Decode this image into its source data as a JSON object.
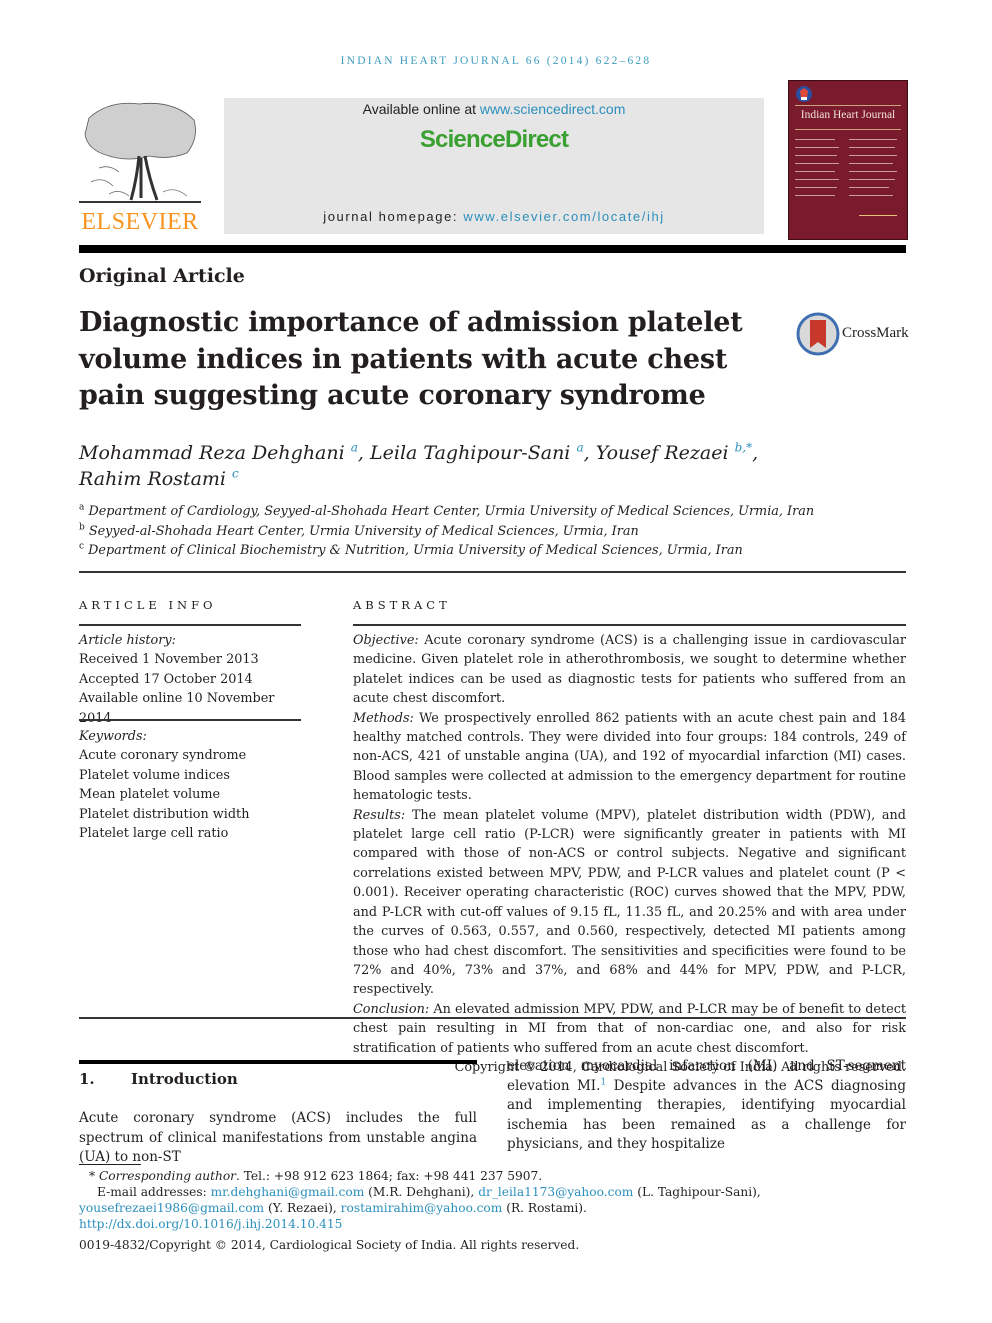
{
  "running_head": "INDIAN HEART JOURNAL 66 (2014) 622–628",
  "publisher": {
    "logo_text": "ELSEVIER"
  },
  "sciencedirect": {
    "available_prefix": "Available online at ",
    "available_link": "www.sciencedirect.com",
    "brand": "ScienceDirect",
    "homepage_prefix": "journal homepage: ",
    "homepage_link": "www.elsevier.com/locate/ihj"
  },
  "journal_cover": {
    "title": "Indian Heart Journal"
  },
  "article_type": "Original Article",
  "title": "Diagnostic importance of admission platelet volume indices in patients with acute chest pain suggesting acute coronary syndrome",
  "crossmark_label": "CrossMark",
  "authors": [
    {
      "name": "Mohammad Reza Dehghani",
      "aff": "a",
      "sep": ", "
    },
    {
      "name": "Leila Taghipour-Sani",
      "aff": "a",
      "sep": ", "
    },
    {
      "name": "Yousef Rezaei",
      "aff": "b,*",
      "sep": ","
    },
    {
      "name": "Rahim Rostami",
      "aff": "c",
      "sep": ""
    }
  ],
  "affiliations": [
    {
      "key": "a",
      "text": "Department of Cardiology, Seyyed-al-Shohada Heart Center, Urmia University of Medical Sciences, Urmia, Iran"
    },
    {
      "key": "b",
      "text": "Seyyed-al-Shohada Heart Center, Urmia University of Medical Sciences, Urmia, Iran"
    },
    {
      "key": "c",
      "text": "Department of Clinical Biochemistry & Nutrition, Urmia University of Medical Sciences, Urmia, Iran"
    }
  ],
  "article_info": {
    "heading": "ARTICLE INFO",
    "history_label": "Article history:",
    "history": [
      "Received 1 November 2013",
      "Accepted 17 October 2014",
      "Available online 10 November 2014"
    ],
    "keywords_label": "Keywords:",
    "keywords": [
      "Acute coronary syndrome",
      "Platelet volume indices",
      "Mean platelet volume",
      "Platelet distribution width",
      "Platelet large cell ratio"
    ]
  },
  "abstract": {
    "heading": "ABSTRACT",
    "sections": [
      {
        "label": "Objective:",
        "text": " Acute coronary syndrome (ACS) is a challenging issue in cardiovascular medicine. Given platelet role in atherothrombosis, we sought to determine whether platelet indices can be used as diagnostic tests for patients who suffered from an acute chest discomfort."
      },
      {
        "label": "Methods:",
        "text": " We prospectively enrolled 862 patients with an acute chest pain and 184 healthy matched controls. They were divided into four groups: 184 controls, 249 of non-ACS, 421 of unstable angina (UA), and 192 of myocardial infarction (MI) cases. Blood samples were collected at admission to the emergency department for routine hematologic tests."
      },
      {
        "label": "Results:",
        "text": " The mean platelet volume (MPV), platelet distribution width (PDW), and platelet large cell ratio (P-LCR) were significantly greater in patients with MI compared with those of non-ACS or control subjects. Negative and significant correlations existed between MPV, PDW, and P-LCR values and platelet count (P < 0.001). Receiver operating characteristic (ROC) curves showed that the MPV, PDW, and P-LCR with cut-off values of 9.15 fL, 11.35 fL, and 20.25% and with area under the curves of 0.563, 0.557, and 0.560, respectively, detected MI patients among those who had chest discomfort. The sensitivities and specificities were found to be 72% and 40%, 73% and 37%, and 68% and 44% for MPV, PDW, and P-LCR, respectively."
      },
      {
        "label": "Conclusion:",
        "text": " An elevated admission MPV, PDW, and P-LCR may be of benefit to detect chest pain resulting in MI from that of non-cardiac one, and also for risk stratification of patients who suffered from an acute chest discomfort."
      }
    ],
    "copyright": "Copyright © 2014, Cardiological Society of India. All rights reserved."
  },
  "introduction": {
    "number": "1.",
    "heading": "Introduction",
    "col1": "Acute coronary syndrome (ACS) includes the full spectrum of clinical manifestations from unstable angina (UA) to non-ST",
    "col2_a": "elevation myocardial infarction (MI) and ST-segment elevation MI.",
    "col2_ref": "1",
    "col2_b": " Despite advances in the ACS diagnosing and implementing therapies, identifying myocardial ischemia has been remained as a challenge for physicians, and they hospitalize"
  },
  "footnotes": {
    "corresponding_label": "Corresponding author",
    "corresponding_text": ". Tel.: +98 912 623 1864; fax: +98 441 237 5907.",
    "email_label": "E-mail addresses: ",
    "emails": [
      {
        "addr": "mr.dehghani@gmail.com",
        "who": " (M.R. Dehghani), "
      },
      {
        "addr": "dr_leila1173@yahoo.com",
        "who": " (L. Taghipour-Sani), "
      },
      {
        "addr": "yousefrezaei1986@gmail.com",
        "who": " (Y. Rezaei), "
      },
      {
        "addr": "rostamirahim@yahoo.com",
        "who": " (R. Rostami)."
      }
    ],
    "doi": "http://dx.doi.org/10.1016/j.ihj.2014.10.415",
    "issn_copyright": "0019-4832/Copyright © 2014, Cardiological Society of India. All rights reserved."
  }
}
